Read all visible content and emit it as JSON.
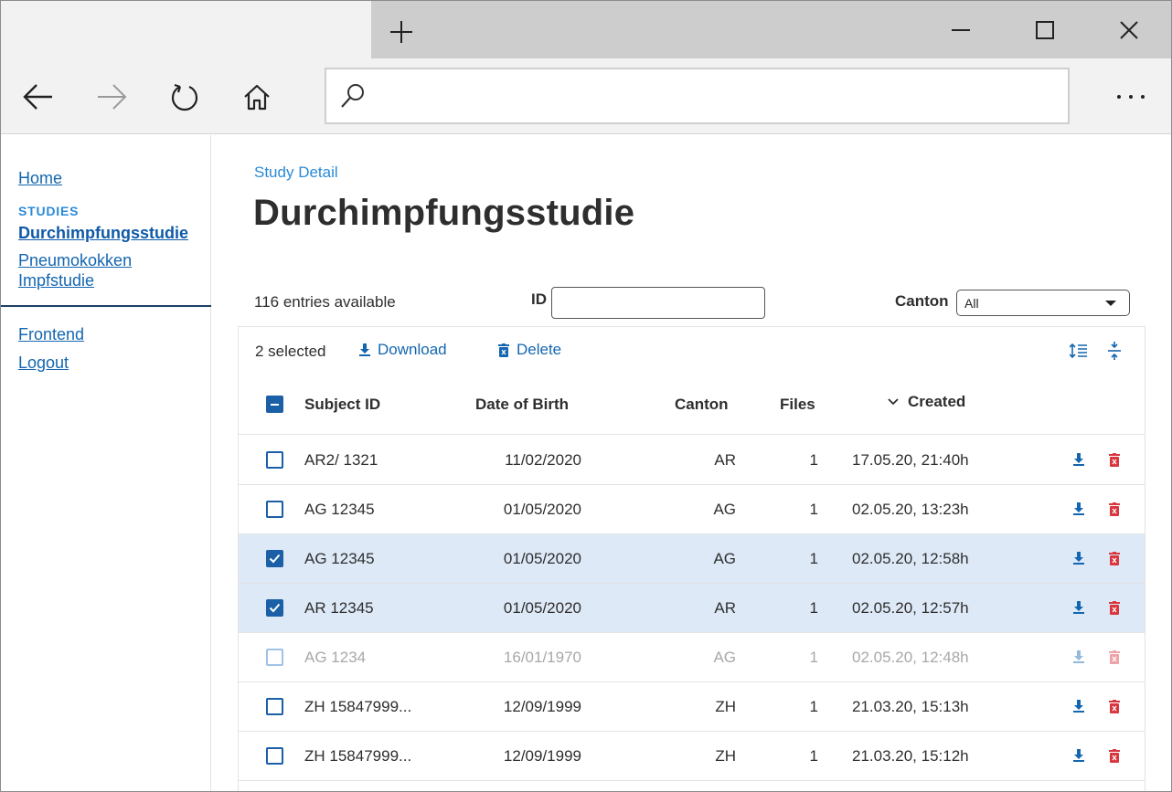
{
  "browser": {
    "new_tab_icon": "plus-icon",
    "address_placeholder": "",
    "icons": [
      "back-arrow-icon",
      "forward-arrow-icon",
      "refresh-icon",
      "home-icon",
      "search-icon",
      "more-icon",
      "minimize-icon",
      "maximize-icon",
      "close-icon"
    ]
  },
  "sidebar": {
    "home": "Home",
    "studies_heading": "STUDIES",
    "studies": [
      "Durchimpfungsstudie",
      "Pneumokokken Impfstudie"
    ],
    "frontend": "Frontend",
    "logout": "Logout"
  },
  "main": {
    "breadcrumb": "Study Detail",
    "title": "Durchimpfungsstudie",
    "entries": "116 entries available",
    "id_label": "ID",
    "id_value": "",
    "canton_label": "Canton",
    "canton_value": "All"
  },
  "table": {
    "selected_count": "2 selected",
    "download_label": "Download",
    "delete_label": "Delete",
    "headers": {
      "subject": "Subject ID",
      "dob": "Date of Birth",
      "canton": "Canton",
      "files": "Files",
      "created": "Created"
    },
    "rows": [
      {
        "subject": "AR2/ 1321",
        "dob": "11/02/2020",
        "canton": "AR",
        "files": "1",
        "created": "17.05.20, 21:40h"
      },
      {
        "subject": "AG 12345",
        "dob": "01/05/2020",
        "canton": "AG",
        "files": "1",
        "created": "02.05.20, 13:23h"
      },
      {
        "subject": "AG 12345",
        "dob": "01/05/2020",
        "canton": "AG",
        "files": "1",
        "created": "02.05.20, 12:58h"
      },
      {
        "subject": "AR 12345",
        "dob": "01/05/2020",
        "canton": "AR",
        "files": "1",
        "created": "02.05.20, 12:57h"
      },
      {
        "subject": "AG 1234",
        "dob": "16/01/1970",
        "canton": "AG",
        "files": "1",
        "created": "02.05.20, 12:48h"
      },
      {
        "subject": "ZH 15847999...",
        "dob": "12/09/1999",
        "canton": "ZH",
        "files": "1",
        "created": "21.03.20, 15:13h"
      },
      {
        "subject": "ZH 15847999...",
        "dob": "12/09/1999",
        "canton": "ZH",
        "files": "1",
        "created": "21.03.20, 15:12h"
      }
    ]
  },
  "colors": {
    "link": "#1466b0",
    "accent": "#2b8ad6",
    "selected_row": "#dde9f7",
    "delete_red": "#d9363e"
  }
}
